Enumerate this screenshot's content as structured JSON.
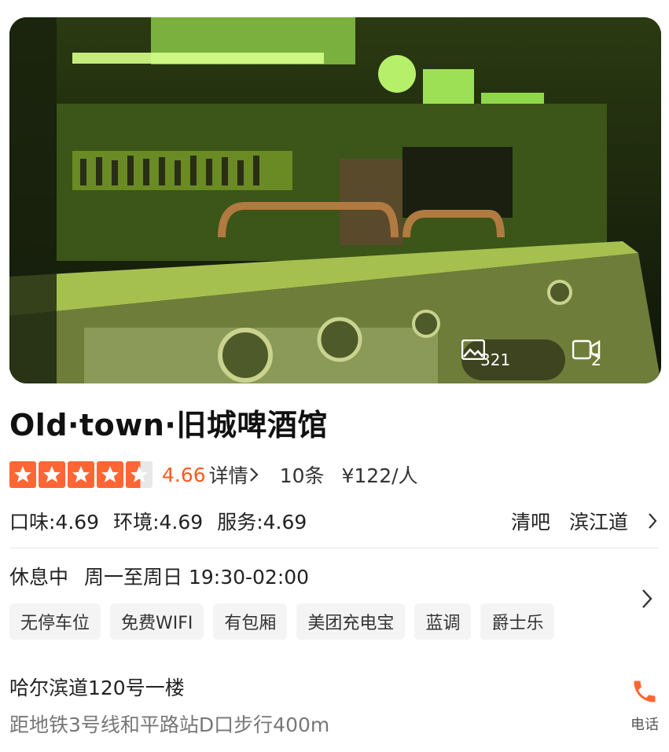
{
  "hero": {
    "photo_count": "321",
    "video_count": "2"
  },
  "shop": {
    "name": "Old·town·旧城啤酒馆",
    "score": "4.66",
    "stars": 4.66,
    "detail_label": "详情",
    "reviews": "10条",
    "price": "¥122/人"
  },
  "subscores": [
    "口味:4.69",
    "环境:4.69",
    "服务:4.69"
  ],
  "category": "清吧",
  "area": "滨江道",
  "status": "休息中",
  "hours": "周一至周日 19:30-02:00",
  "tags": [
    "无停车位",
    "免费WIFI",
    "有包厢",
    "美团充电宝",
    "蓝调",
    "爵士乐"
  ],
  "address": "哈尔滨道120号一楼",
  "distance": "距地铁3号线和平路站D口步行400m",
  "call_label": "电话",
  "colors": {
    "accent": "#ff6633",
    "score": "#ff5a1f"
  },
  "icons": [
    "photo-icon",
    "video-icon",
    "chevron-right-icon",
    "phone-icon",
    "star-icon"
  ]
}
